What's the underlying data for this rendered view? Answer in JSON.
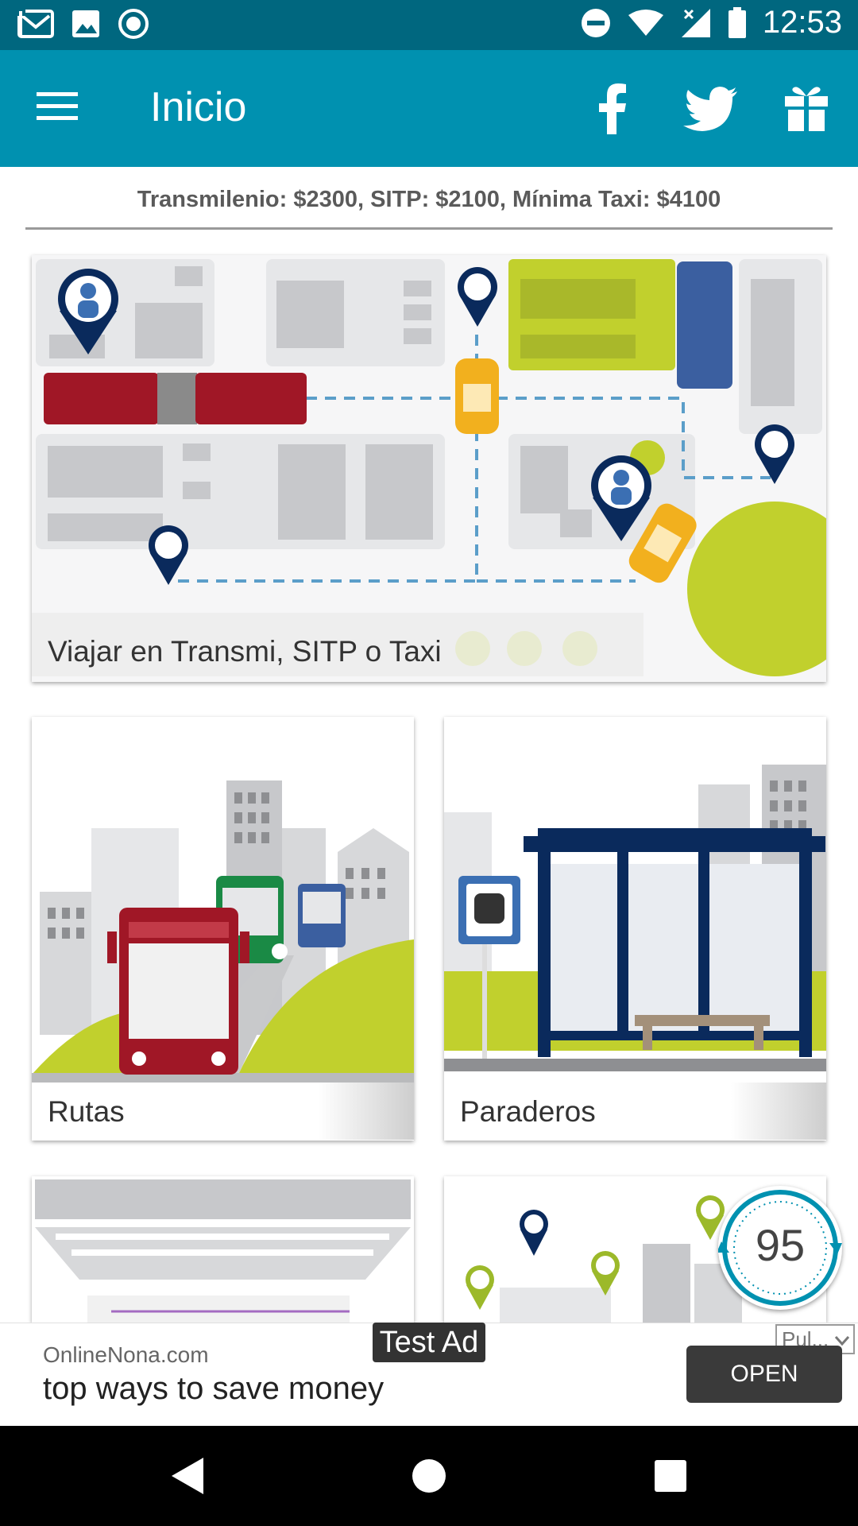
{
  "status_bar": {
    "time": "12:53",
    "left_icons": [
      "gmail-icon",
      "image-icon",
      "sync-icon"
    ],
    "right_icons": [
      "do-not-disturb-icon",
      "wifi-icon",
      "signal-icon",
      "battery-icon"
    ]
  },
  "app_bar": {
    "title": "Inicio",
    "actions": [
      "facebook-icon",
      "twitter-icon",
      "gift-icon"
    ]
  },
  "fares": {
    "text": "Transmilenio: $2300, SITP: $2100, Mínima Taxi: $4100"
  },
  "cards": [
    {
      "label": "Viajar en Transmi, SITP o Taxi"
    },
    {
      "label": "Rutas"
    },
    {
      "label": "Paraderos"
    }
  ],
  "timer": {
    "value": "95"
  },
  "pub_select": {
    "value": "Pul..."
  },
  "ad": {
    "tag": "Test Ad",
    "domain": "OnlineNona.com",
    "headline": "top ways to save money",
    "cta": "OPEN"
  },
  "colors": {
    "status_bar": "#00677f",
    "app_bar": "#0091b0",
    "accent_green": "#c1d02d",
    "bus_red": "#a01726",
    "navy": "#0a2a5c",
    "taxi_yellow": "#f2b01e"
  }
}
